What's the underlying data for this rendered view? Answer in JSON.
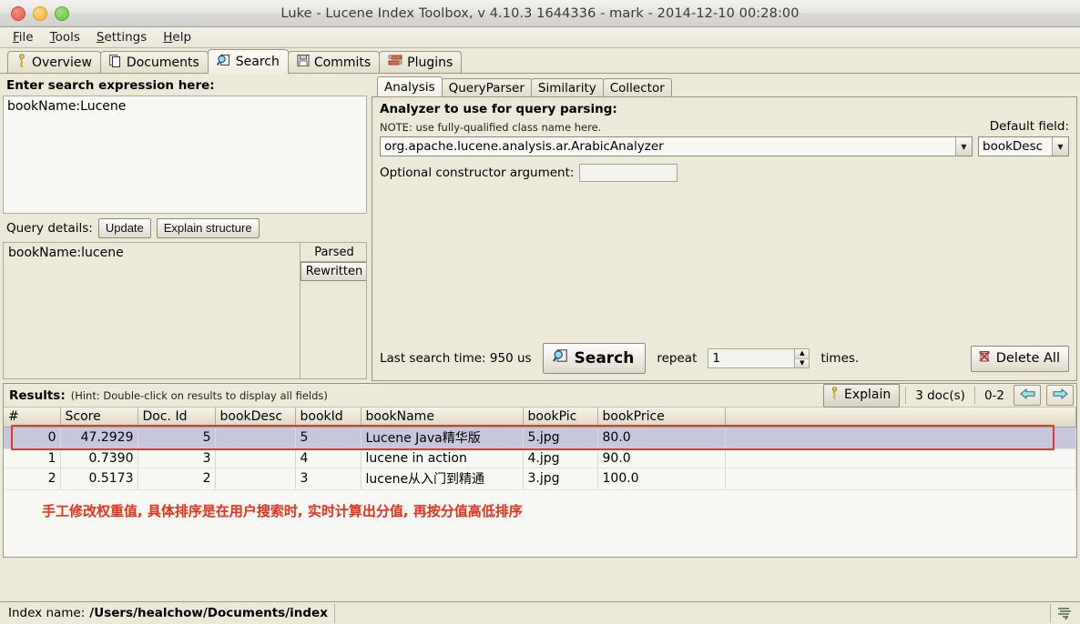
{
  "window": {
    "title": "Luke - Lucene Index Toolbox, v 4.10.3 1644336 - mark - 2014-12-10 00:28:00",
    "controls": {
      "close": "close-button",
      "minimize": "minimize-button",
      "maximize": "maximize-button"
    }
  },
  "menubar": {
    "items": [
      {
        "label": "File",
        "mnemonic": "F",
        "rest": "ile"
      },
      {
        "label": "Tools",
        "mnemonic": "T",
        "rest": "ools"
      },
      {
        "label": "Settings",
        "mnemonic": "S",
        "rest": "ettings"
      },
      {
        "label": "Help",
        "mnemonic": "H",
        "rest": "elp"
      }
    ]
  },
  "tabs": [
    {
      "label": "Overview",
      "icon": "person-icon",
      "active": false
    },
    {
      "label": "Documents",
      "icon": "documents-icon",
      "active": false
    },
    {
      "label": "Search",
      "icon": "search-magnifier-icon",
      "active": true
    },
    {
      "label": "Commits",
      "icon": "floppy-disk-icon",
      "active": false
    },
    {
      "label": "Plugins",
      "icon": "plugins-icon",
      "active": false
    }
  ],
  "left_panel": {
    "expression_label": "Enter search expression here:",
    "expression_value": "bookName:Lucene",
    "query_details_label": "Query details:",
    "update_button": "Update",
    "explain_structure_button": "Explain structure",
    "parsed_query": "bookName:lucene",
    "parsed_tab": "Parsed",
    "rewritten_tab": "Rewritten"
  },
  "right_panel": {
    "tabs": [
      {
        "label": "Analysis",
        "active": true
      },
      {
        "label": "QueryParser",
        "active": false
      },
      {
        "label": "Similarity",
        "active": false
      },
      {
        "label": "Collector",
        "active": false
      }
    ],
    "analyzer_title": "Analyzer to use for query parsing:",
    "analyzer_note": "NOTE: use fully-qualified class name here.",
    "default_field_label": "Default field:",
    "analyzer_value": "org.apache.lucene.analysis.ar.ArabicAnalyzer",
    "default_field_value": "bookDesc",
    "optional_arg_label": "Optional constructor argument:",
    "optional_arg_value": "",
    "last_search_time": "Last search time: 950 us",
    "search_button": "Search",
    "repeat_label": "repeat",
    "repeat_value": "1",
    "times_label": "times.",
    "delete_all_button": "Delete All"
  },
  "results": {
    "label": "Results:",
    "hint": "(Hint: Double-click on results to display all fields)",
    "explain_button": "Explain",
    "doc_count": "3 doc(s)",
    "range": "0-2",
    "prev_arrow": "left-arrow-icon",
    "next_arrow": "right-arrow-icon",
    "columns": [
      "#",
      "Score",
      "Doc. Id",
      "bookDesc",
      "bookId",
      "bookName",
      "bookPic",
      "bookPrice"
    ],
    "rows": [
      {
        "num": "0",
        "score": "47.2929",
        "doc_id": "5",
        "bookDesc": "",
        "bookId": "5",
        "bookName": "Lucene Java精华版",
        "bookPic": "5.jpg",
        "bookPrice": "80.0",
        "selected": true
      },
      {
        "num": "1",
        "score": "0.7390",
        "doc_id": "3",
        "bookDesc": "",
        "bookId": "4",
        "bookName": "lucene in action",
        "bookPic": "4.jpg",
        "bookPrice": "90.0",
        "selected": false
      },
      {
        "num": "2",
        "score": "0.5173",
        "doc_id": "2",
        "bookDesc": "",
        "bookId": "3",
        "bookName": "lucene从入门到精通",
        "bookPic": "3.jpg",
        "bookPrice": "100.0",
        "selected": false
      }
    ],
    "annotation": "手工修改权重值, 具体排序是在用户搜索时, 实时计算出分值, 再按分值高低排序",
    "annotation_color": "#e8301a",
    "highlight_color": "#c6c6dd",
    "highlight_border_color": "#e03a28"
  },
  "statusbar": {
    "index_name_label": "Index name:",
    "index_path": "/Users/healchow/Documents/index",
    "grip_icon": "resize-grip-icon"
  }
}
